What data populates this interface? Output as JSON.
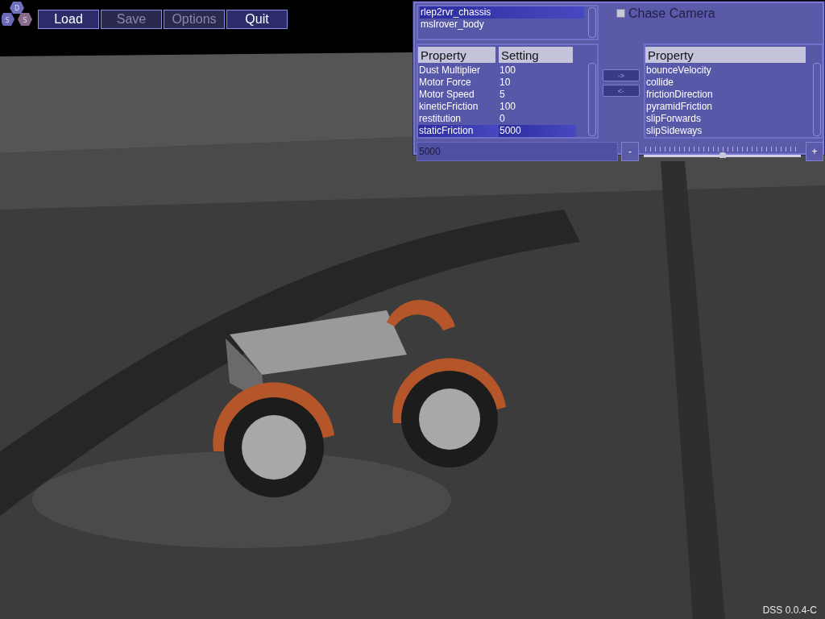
{
  "toolbar": {
    "buttons": [
      {
        "label": "Load",
        "disabled": false
      },
      {
        "label": "Save",
        "disabled": true
      },
      {
        "label": "Options",
        "disabled": true
      },
      {
        "label": "Quit",
        "disabled": false
      }
    ]
  },
  "logo": {
    "letters": [
      "D",
      "S",
      "S"
    ]
  },
  "panel": {
    "objects": [
      {
        "label": "rlep2rvr_chassis",
        "selected": true
      },
      {
        "label": "mslrover_body",
        "selected": false
      }
    ],
    "chase_camera": {
      "label": "Chase Camera",
      "checked": false
    },
    "table": {
      "columns": [
        "Property",
        "Setting"
      ],
      "rows": [
        {
          "property": "Dust Multiplier",
          "setting": "100",
          "selected": false
        },
        {
          "property": "Motor Force",
          "setting": "10",
          "selected": false
        },
        {
          "property": "Motor Speed",
          "setting": "5",
          "selected": false
        },
        {
          "property": "kineticFriction",
          "setting": "100",
          "selected": false
        },
        {
          "property": "restitution",
          "setting": "0",
          "selected": false
        },
        {
          "property": "staticFriction",
          "setting": "5000",
          "selected": true
        }
      ]
    },
    "move_buttons": [
      "->",
      "<-"
    ],
    "available": {
      "column": "Property",
      "items": [
        "bounceVelocity",
        "collide",
        "frictionDirection",
        "pyramidFriction",
        "slipForwards",
        "slipSideways"
      ]
    },
    "value_field": {
      "value": "5000"
    },
    "minus_button": "-",
    "slider": {
      "level": 0.5
    },
    "plus_button": "+"
  },
  "version": "DSS 0.0.4-C"
}
